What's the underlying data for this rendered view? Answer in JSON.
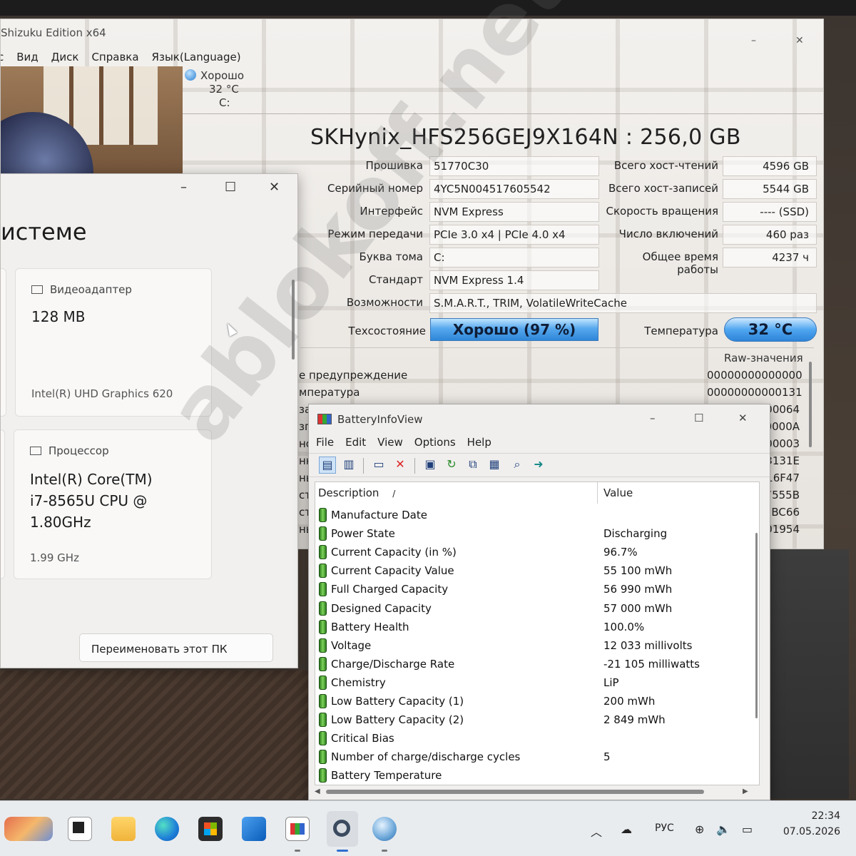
{
  "cdi": {
    "title": "Shizuku Edition x64",
    "menu": [
      "Вид",
      "Диск",
      "Справка",
      "Язык(Language)"
    ],
    "drive_tab": {
      "status": "Хорошо",
      "temp": "32 °C",
      "letter": "C:"
    },
    "model": "SKHynix_HFS256GEJ9X164N : 256,0 GB",
    "left_fields": [
      {
        "label": "Прошивка",
        "value": "51770C30"
      },
      {
        "label": "Серийный номер",
        "value": "4YC5N004517605542"
      },
      {
        "label": "Интерфейс",
        "value": "NVM Express"
      },
      {
        "label": "Режим передачи",
        "value": "PCIe 3.0 x4 | PCIe 4.0 x4"
      },
      {
        "label": "Буква тома",
        "value": "C:"
      },
      {
        "label": "Стандарт",
        "value": "NVM Express 1.4"
      },
      {
        "label": "Возможности",
        "value": "S.M.A.R.T., TRIM, VolatileWriteCache"
      }
    ],
    "right_fields": [
      {
        "label": "Всего хост-чтений",
        "value": "4596 GB"
      },
      {
        "label": "Всего хост-записей",
        "value": "5544 GB"
      },
      {
        "label": "Скорость вращения",
        "value": "---- (SSD)"
      },
      {
        "label": "Число включений",
        "value": "460 раз"
      },
      {
        "label": "Общее время работы",
        "value": "4237 ч"
      }
    ],
    "health_label": "Техсостояние",
    "health_value": "Хорошо  (97 %)",
    "temp_label": "Температура",
    "temp_value": "32 °C",
    "raw_header": "Raw-значения",
    "raw_rows": [
      {
        "label": "е предупреждение",
        "value": "00000000000000"
      },
      {
        "label": "мпература",
        "value": "00000000000131"
      },
      {
        "label": "зап",
        "value": "000064"
      },
      {
        "label": "зпи",
        "value": "0000A"
      },
      {
        "label": "но",
        "value": "00003"
      },
      {
        "label": "нн",
        "value": "93131E"
      },
      {
        "label": "ны",
        "value": "316F47"
      },
      {
        "label": "ст",
        "value": "7555B"
      },
      {
        "label": "ст",
        "value": "2BC66"
      },
      {
        "label": "нь",
        "value": "001954"
      }
    ]
  },
  "settings": {
    "heading": "истеме",
    "gpu_card": {
      "title": "Видеоадаптер",
      "value": "128 MB",
      "sub": "Intel(R) UHD Graphics 620"
    },
    "cpu_card": {
      "title": "Процессор",
      "value_lines": [
        "Intel(R) Core(TM)",
        "i7-8565U CPU @",
        "1.80GHz"
      ],
      "sub": "1.99 GHz"
    },
    "rename_button": "Переименовать этот ПК"
  },
  "biv": {
    "title": "BatteryInfoView",
    "menu": [
      "File",
      "Edit",
      "View",
      "Options",
      "Help"
    ],
    "col_desc": "Description",
    "col_sort_mark": "/",
    "col_value": "Value",
    "rows": [
      {
        "desc": "Manufacture Date",
        "value": ""
      },
      {
        "desc": "Power State",
        "value": "Discharging"
      },
      {
        "desc": "Current Capacity (in %)",
        "value": "96.7%"
      },
      {
        "desc": "Current Capacity Value",
        "value": "55 100 mWh"
      },
      {
        "desc": "Full Charged Capacity",
        "value": "56 990 mWh"
      },
      {
        "desc": "Designed Capacity",
        "value": "57 000 mWh"
      },
      {
        "desc": "Battery Health",
        "value": "100.0%"
      },
      {
        "desc": "Voltage",
        "value": "12 033 millivolts"
      },
      {
        "desc": "Charge/Discharge Rate",
        "value": "-21 105 milliwatts"
      },
      {
        "desc": "Chemistry",
        "value": "LiP"
      },
      {
        "desc": "Low Battery Capacity (1)",
        "value": "200 mWh"
      },
      {
        "desc": "Low Battery Capacity (2)",
        "value": "2 849 mWh"
      },
      {
        "desc": "Critical Bias",
        "value": ""
      },
      {
        "desc": "Number of charge/discharge cycles",
        "value": "5"
      },
      {
        "desc": "Battery Temperature",
        "value": ""
      }
    ]
  },
  "taskbar": {
    "lang": "РУС",
    "time": "22:34",
    "date": "07.05.2026"
  },
  "watermark": "ablokoff.net",
  "icons": {
    "window_min": "–",
    "window_max": "☐",
    "window_close": "✕",
    "chevron_up": "︿",
    "cloud_off": "☁",
    "globe": "⊕",
    "volume": "🔈",
    "battery": "▭",
    "cursor": "pointer-arrow-icon"
  },
  "colors": {
    "accent": "#2f86d8",
    "health_blue": "#56a8ee",
    "battery_green": "#7ed35a"
  }
}
